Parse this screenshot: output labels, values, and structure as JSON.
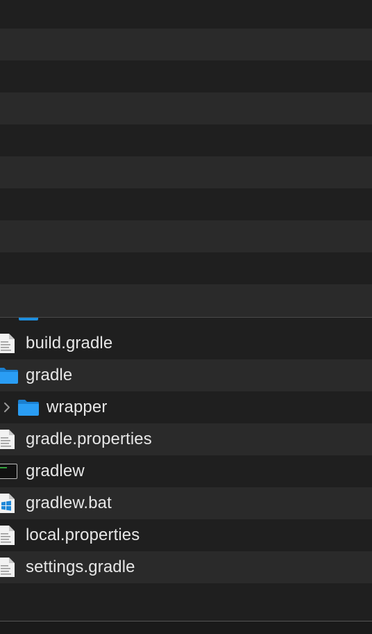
{
  "colors": {
    "background": "#1f1f1f",
    "stripe_alt": "#2a2a2a",
    "text": "#e6e6e6",
    "folder_blue": "#1d8ede"
  },
  "files": [
    {
      "name": "build.gradle",
      "icon": "document-icon"
    },
    {
      "name": "gradle",
      "icon": "folder-icon"
    },
    {
      "name": "wrapper",
      "icon": "folder-icon",
      "indent": 1,
      "expandable": true
    },
    {
      "name": "gradle.properties",
      "icon": "document-icon"
    },
    {
      "name": "gradlew",
      "icon": "terminal-icon"
    },
    {
      "name": "gradlew.bat",
      "icon": "windows-icon"
    },
    {
      "name": "local.properties",
      "icon": "document-icon"
    },
    {
      "name": "settings.gradle",
      "icon": "document-icon"
    }
  ]
}
